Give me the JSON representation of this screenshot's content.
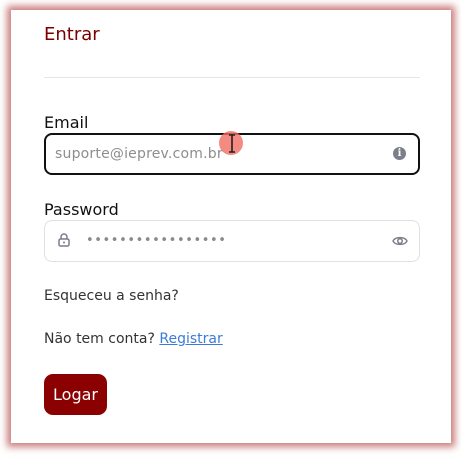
{
  "form": {
    "title": "Entrar",
    "email": {
      "label": "Email",
      "value": "suporte@ieprev.com.br"
    },
    "password": {
      "label": "Password",
      "masked_value": "•••••••••••••••••"
    },
    "forgot_password": "Esqueceu a senha?",
    "signup_prompt": "Não tem conta?",
    "signup_link": "Registrar",
    "submit_label": "Logar"
  },
  "icons": {
    "email_trailing": "info-circle-icon",
    "password_leading": "lock-icon",
    "password_trailing": "eye-icon"
  },
  "colors": {
    "brand": "#8b0000",
    "title": "#7a0000",
    "link": "#3b7bd8",
    "shadow": "#a01414"
  }
}
